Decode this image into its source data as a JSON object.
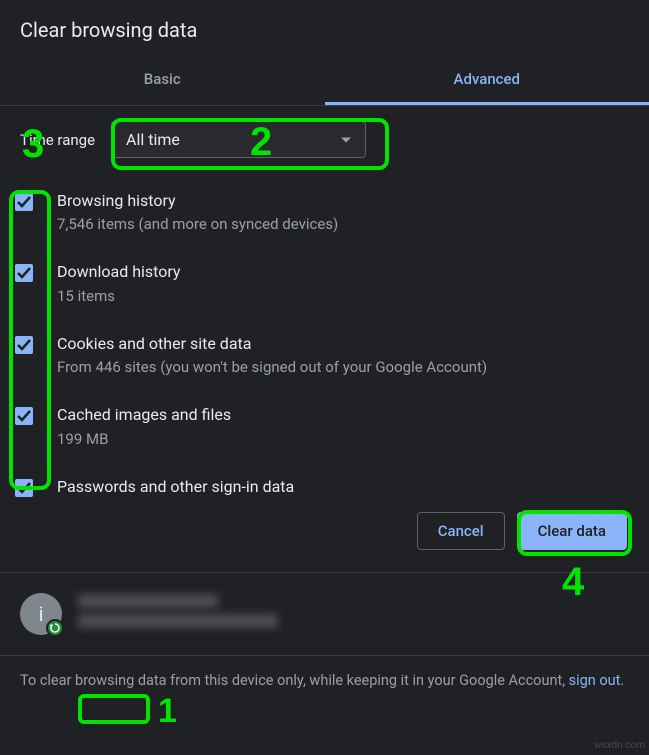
{
  "dialog": {
    "title": "Clear browsing data"
  },
  "tabs": {
    "basic": "Basic",
    "advanced": "Advanced"
  },
  "time": {
    "label": "Time range",
    "selected": "All time"
  },
  "options": [
    {
      "title": "Browsing history",
      "sub": "7,546 items (and more on synced devices)"
    },
    {
      "title": "Download history",
      "sub": "15 items"
    },
    {
      "title": "Cookies and other site data",
      "sub": "From 446 sites (you won't be signed out of your Google Account)"
    },
    {
      "title": "Cached images and files",
      "sub": "199 MB"
    },
    {
      "title": "Passwords and other sign-in data",
      "sub": ""
    }
  ],
  "buttons": {
    "cancel": "Cancel",
    "clear": "Clear data"
  },
  "account": {
    "avatar_initial": "i"
  },
  "note": {
    "before": "To clear browsing data from this device only, while keeping it in your Google Account, ",
    "link": "sign out",
    "after": "."
  },
  "annotations": {
    "n1": "1",
    "n2": "2",
    "n3": "3",
    "n4": "4"
  },
  "watermark": "wsxdn.com"
}
